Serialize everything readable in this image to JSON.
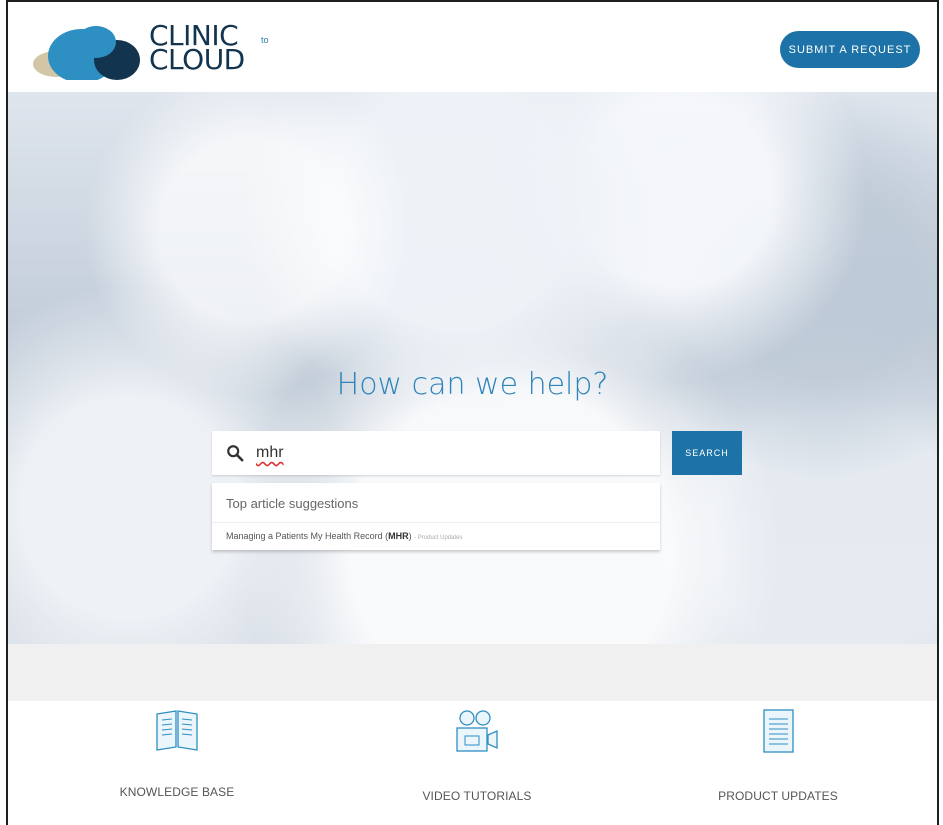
{
  "logo": {
    "line1": "CLINIC",
    "line2": "CLOUD",
    "to": "to"
  },
  "header": {
    "submit_label": "SUBMIT A REQUEST"
  },
  "hero": {
    "title": "How can we help?"
  },
  "search": {
    "value": "mhr",
    "button_label": "SEARCH"
  },
  "suggestions": {
    "title": "Top article suggestions",
    "item": {
      "prefix": "Managing a Patients My Health Record (",
      "bold": "MHR",
      "suffix": ")",
      "tag": "- Product Updates"
    }
  },
  "categories": [
    {
      "label": "KNOWLEDGE BASE",
      "icon": "book-icon"
    },
    {
      "label": "VIDEO TUTORIALS",
      "icon": "video-camera-icon"
    },
    {
      "label": "PRODUCT UPDATES",
      "icon": "document-icon"
    }
  ],
  "colors": {
    "accent": "#1d73a7",
    "hero_title": "#2e83ba",
    "logo_navy": "#12344f",
    "logo_light_blue": "#2e8fc2",
    "logo_sand": "#d2c6a7"
  }
}
